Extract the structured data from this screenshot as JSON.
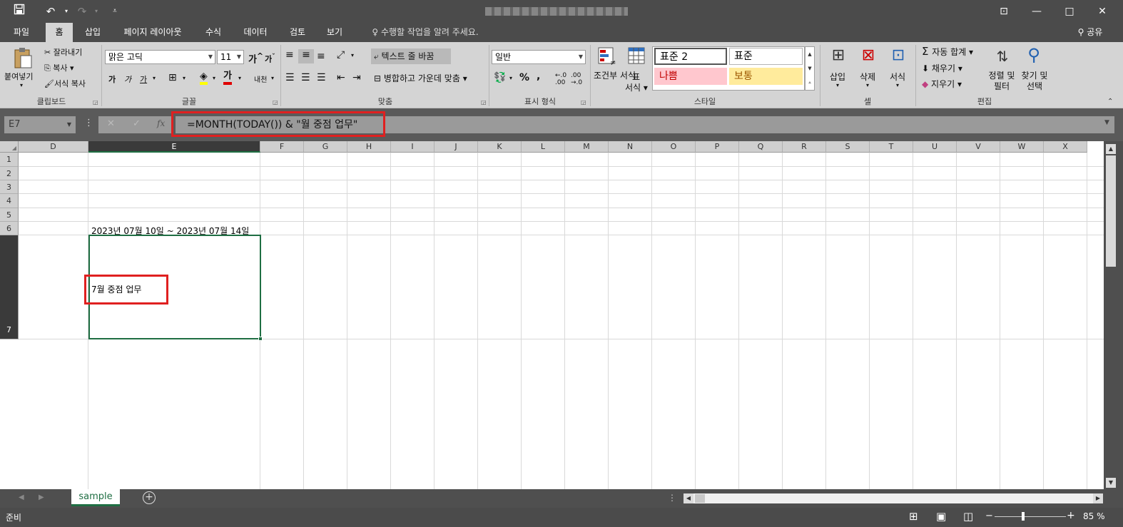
{
  "titlebar": {
    "save_icon": "save-icon",
    "undo_icon": "undo-icon",
    "redo_icon": "redo-icon",
    "customize_icon": "customize-qat-icon",
    "ribbon_display_icon": "ribbon-display-icon",
    "minimize_glyph": "—",
    "maximize_glyph": "□",
    "close_glyph": "✕"
  },
  "tabs": {
    "file": "파일",
    "home": "홈",
    "insert": "삽입",
    "page_layout": "페이지 레이아웃",
    "formulas": "수식",
    "data": "데이터",
    "review": "검토",
    "view": "보기",
    "tell_me": "수행할 작업을 알려 주세요.",
    "share": "공유"
  },
  "ribbon": {
    "clipboard": {
      "paste": "붙여넣기",
      "cut": "잘라내기",
      "copy": "복사",
      "format_painter": "서식 복사",
      "label": "클립보드"
    },
    "font": {
      "name": "맑은 고딕",
      "size": "11",
      "bold": "가",
      "italic": "가",
      "underline": "가",
      "font_color_letter": "가",
      "phonetic": "내천",
      "grow_letter": "가",
      "shrink_letter": "가",
      "label": "글꼴"
    },
    "alignment": {
      "wrap_text": "텍스트 줄 바꿈",
      "merge_center": "병합하고 가운데 맞춤",
      "label": "맞춤"
    },
    "number": {
      "format": "일반",
      "percent": "%",
      "comma": ",",
      "label": "표시 형식"
    },
    "styles": {
      "conditional": "조건부 서식",
      "table_line1": "표",
      "table_line2": "서식",
      "normal2": "표준 2",
      "normal": "표준",
      "bad": "나쁨",
      "neutral": "보통",
      "label": "스타일"
    },
    "cells": {
      "insert": "삽입",
      "delete": "삭제",
      "format": "서식",
      "label": "셀"
    },
    "editing": {
      "autosum": "자동 합계",
      "fill": "채우기",
      "clear": "지우기",
      "sort_filter": "정렬 및 필터",
      "find_select": "찾기 및 선택",
      "label": "편집"
    }
  },
  "formula_bar": {
    "name_box": "E7",
    "fx": "fx",
    "cancel": "✕",
    "enter": "✓",
    "formula": "=MONTH(TODAY()) & \"월 중점 업무\""
  },
  "columns": [
    "D",
    "E",
    "F",
    "G",
    "H",
    "I",
    "J",
    "K",
    "L",
    "M",
    "N",
    "O",
    "P",
    "Q",
    "R",
    "S",
    "T",
    "U",
    "V",
    "W",
    "X"
  ],
  "rows": [
    "1",
    "2",
    "3",
    "4",
    "5",
    "6",
    "7"
  ],
  "cells": {
    "E6": "2023년 07월 10일 ~ 2023년 07월 14일",
    "E7": "7월 중점 업무"
  },
  "sheet_tabs": {
    "active": "sample",
    "add": "+"
  },
  "status": {
    "ready": "준비",
    "zoom": "85 %"
  },
  "colors": {
    "accent_green": "#1f6e43",
    "highlight_red": "#e02020",
    "bad_bg": "#ffc7ce",
    "bad_fg": "#9c0006",
    "neutral_bg": "#ffeb9c",
    "neutral_fg": "#9c5700"
  }
}
